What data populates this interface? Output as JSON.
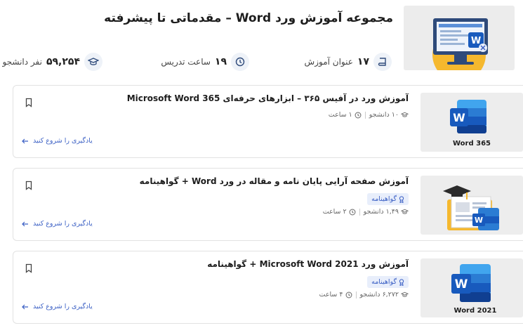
{
  "header": {
    "title": "مجموعه آموزش ورد Word – مقدماتی تا پیشرفته",
    "stats": {
      "lessons_num": "۱۷",
      "lessons_label": "عنوان آموزش",
      "hours_num": "۱۹",
      "hours_label": "ساعت تدریس",
      "students_num": "۵۹,۲۵۴",
      "students_label": "نفر دانشجو"
    },
    "icons": [
      "book-icon",
      "clock-icon",
      "graduation-cap-icon"
    ]
  },
  "courses": [
    {
      "title": "آموزش ورد در آفیس ۳۶۵ – ابزارهای حرفه‌ای Microsoft Word 365",
      "students": "۱۰ دانشجو",
      "duration": "۱ ساعت",
      "start_label": "یادگیری را شروع کنید",
      "thumb_caption": "Word 365"
    },
    {
      "title": "آموزش صفحه آرایی پایان نامه و مقاله در ورد Word + گواهینامه",
      "badge": "گواهینامه",
      "students": "۱,۴۹ دانشجو",
      "duration": "۲ ساعت",
      "start_label": "یادگیری را شروع کنید"
    },
    {
      "title": "آموزش ورد Microsoft Word 2021 + گواهینامه",
      "badge": "گواهینامه",
      "students": "۶,۲۷۲ دانشجو",
      "duration": "۴ ساعت",
      "start_label": "یادگیری را شروع کنید",
      "thumb_caption": "Word 2021"
    }
  ],
  "colors": {
    "accent": "#3a5fc4",
    "word_blue": "#185abd",
    "badge_bg": "#e8eefb",
    "thumb_bg": "#ededed",
    "hero_yellow": "#f5b82e"
  }
}
